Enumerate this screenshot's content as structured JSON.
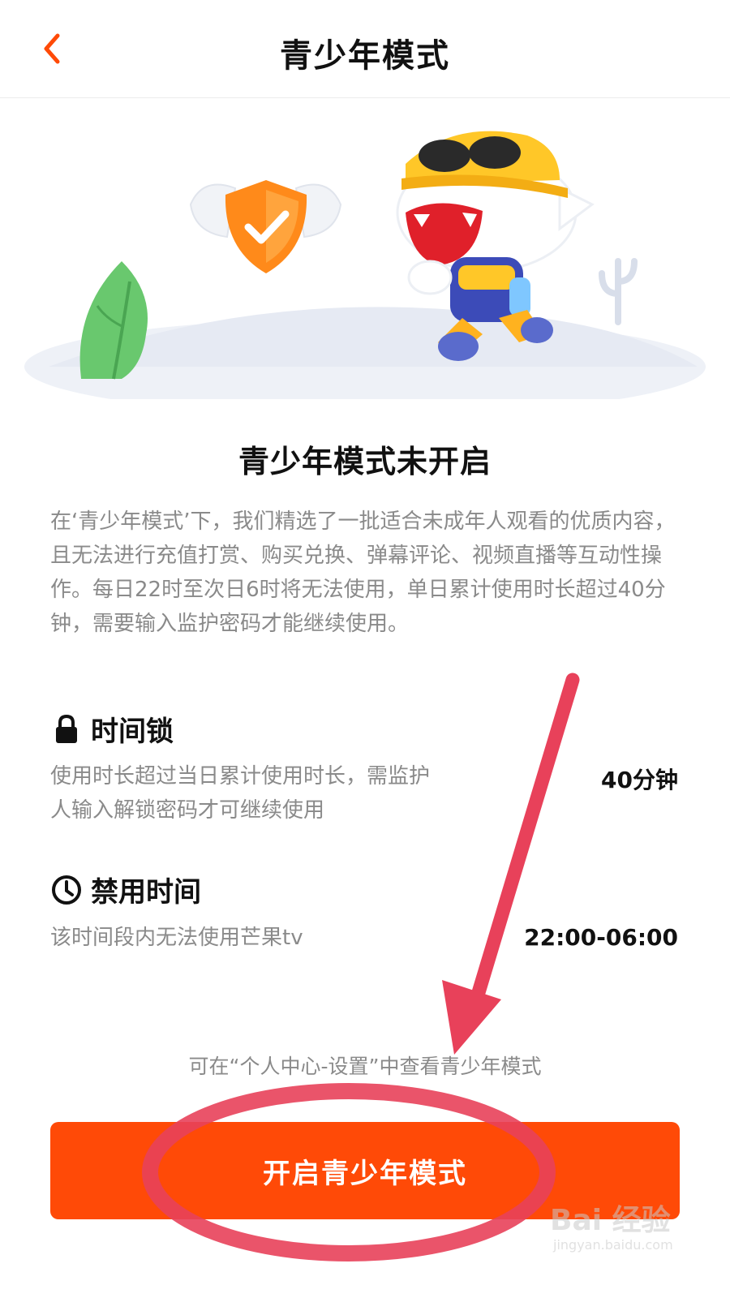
{
  "header": {
    "title": "青少年模式",
    "back_icon": "chevron-left-icon",
    "accent": "#ff4a07"
  },
  "main": {
    "status_title": "青少年模式未开启",
    "description": "在‘青少年模式’下，我们精选了一批适合未成年人观看的优质内容，且无法进行充值打赏、购买兑换、弹幕评论、视频直播等互动性操作。每日22时至次日6时将无法使用，单日累计使用时长超过40分钟，需要输入监护密码才能继续使用。",
    "time_lock": {
      "icon": "lock-icon",
      "title": "时间锁",
      "desc_line1": "使用时长超过当日累计使用时长，需监护",
      "desc_line2": "人输入解锁密码才可继续使用",
      "value": "40分钟"
    },
    "disabled_time": {
      "icon": "clock-icon",
      "title": "禁用时间",
      "desc": "该时间段内无法使用芒果tv",
      "value": "22:00-06:00"
    },
    "hint": "可在“个人中心-设置”中查看青少年模式",
    "button_label": "开启青少年模式",
    "button_color": "#ff4a07"
  },
  "annotation": {
    "arrow_color": "#e8415a",
    "circle_color": "#e8415a"
  },
  "watermark": {
    "brand": "Bai 经验",
    "url": "jingyan.baidu.com"
  }
}
